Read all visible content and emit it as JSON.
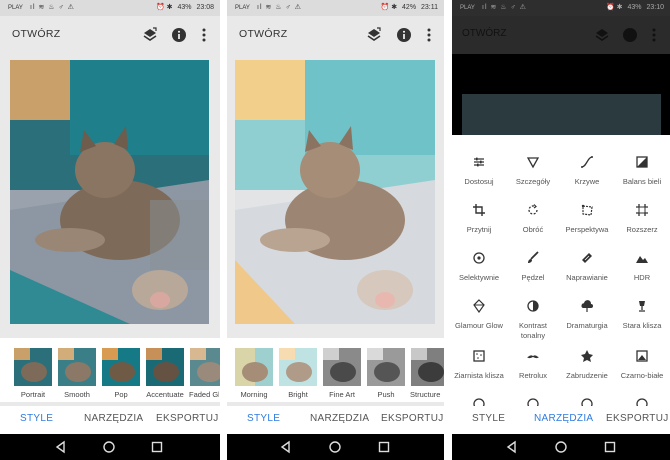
{
  "status": {
    "carrier": "PLAY",
    "left_icons": "ıl ≋ ♨ ♂ ⚠",
    "battery_icon": "⏰ ✱",
    "screens": [
      {
        "battery": "43%",
        "time": "23:08"
      },
      {
        "battery": "42%",
        "time": "23:11"
      },
      {
        "battery": "43%",
        "time": "23:10"
      }
    ]
  },
  "app": {
    "title": "OTWÓRZ"
  },
  "screen1": {
    "looks": [
      {
        "label": "Portrait"
      },
      {
        "label": "Smooth"
      },
      {
        "label": "Pop"
      },
      {
        "label": "Accentuate"
      },
      {
        "label": "Faded Gl"
      }
    ]
  },
  "screen2": {
    "looks": [
      {
        "label": "Morning"
      },
      {
        "label": "Bright"
      },
      {
        "label": "Fine Art"
      },
      {
        "label": "Push"
      },
      {
        "label": "Structure"
      }
    ]
  },
  "tabs": {
    "style": "STYLE",
    "tools": "NARZĘDZIA",
    "export": "EKSPORTUJ"
  },
  "tools": [
    {
      "label": "Dostosuj",
      "icon": "tune-icon"
    },
    {
      "label": "Szczegóły",
      "icon": "details-triangle-icon"
    },
    {
      "label": "Krzywe",
      "icon": "curves-icon"
    },
    {
      "label": "Balans bieli",
      "icon": "white-balance-icon"
    },
    {
      "label": "Przytnij",
      "icon": "crop-icon"
    },
    {
      "label": "Obróć",
      "icon": "rotate-icon"
    },
    {
      "label": "Perspektywa",
      "icon": "perspective-icon"
    },
    {
      "label": "Rozszerz",
      "icon": "expand-icon"
    },
    {
      "label": "Selektywnie",
      "icon": "selective-icon"
    },
    {
      "label": "Pędzel",
      "icon": "brush-icon"
    },
    {
      "label": "Naprawianie",
      "icon": "healing-icon"
    },
    {
      "label": "HDR",
      "icon": "hdr-mountain-icon"
    },
    {
      "label": "Glamour Glow",
      "icon": "glamour-glow-icon"
    },
    {
      "label": "Kontrast tonalny",
      "icon": "tonal-contrast-icon"
    },
    {
      "label": "Dramaturgia",
      "icon": "drama-cloud-icon"
    },
    {
      "label": "Stara klisza",
      "icon": "vintage-lamp-icon"
    },
    {
      "label": "Ziarnista klisza",
      "icon": "grainy-film-icon"
    },
    {
      "label": "Retrolux",
      "icon": "retrolux-mustache-icon"
    },
    {
      "label": "Zabrudzenie",
      "icon": "grunge-icon"
    },
    {
      "label": "Czarno-białe",
      "icon": "black-white-icon"
    }
  ],
  "colors": {
    "accent": "#2f7be0",
    "bar": "#e9e9e9",
    "nav": "#000000"
  }
}
